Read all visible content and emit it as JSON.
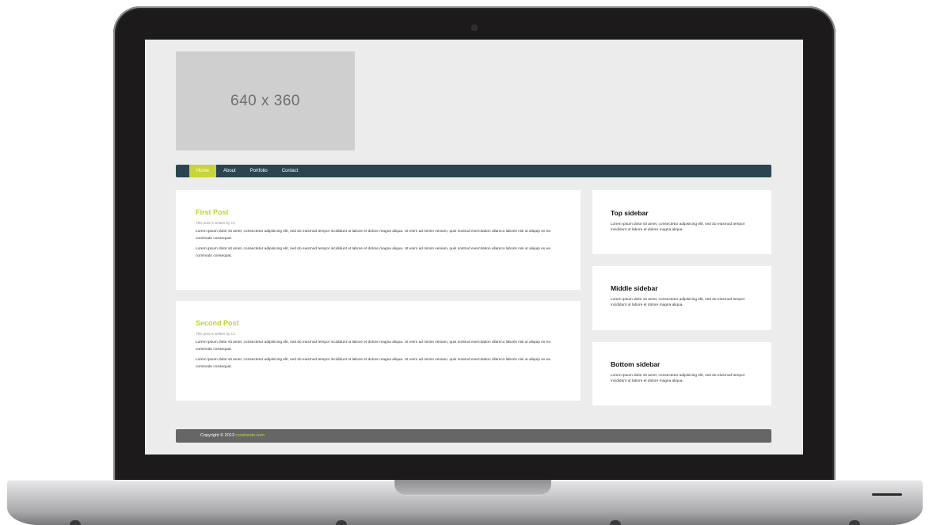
{
  "placeholder": {
    "label": "640 x 360"
  },
  "nav": {
    "items": [
      {
        "label": "Home",
        "active": true
      },
      {
        "label": "About",
        "active": false
      },
      {
        "label": "Portfolio",
        "active": false
      },
      {
        "label": "Contact",
        "active": false
      }
    ]
  },
  "posts": [
    {
      "title": "First Post",
      "byline": "This post is written by CJ",
      "paragraphs": [
        "Lorem ipsum dolor sit amet, consectetur adipisicing elit, sed do eiusmod tempor incididunt ut labore et dolore magna aliqua. Ut enim ad minim veniam, quis nostrud exercitation ullamco laboris nisi ut aliquip ex ea commodo consequat.",
        "Lorem ipsum dolor sit amet, consectetur adipisicing elit, sed do eiusmod tempor incididunt ut labore et dolore magna aliqua. Ut enim ad minim veniam, quis nostrud exercitation ullamco laboris nisi ut aliquip ex ea commodo consequat."
      ]
    },
    {
      "title": "Second Post",
      "byline": "This post is written by CJ",
      "paragraphs": [
        "Lorem ipsum dolor sit amet, consectetur adipisicing elit, sed do eiusmod tempor incididunt ut labore et dolore magna aliqua. Ut enim ad minim veniam, quis nostrud exercitation ullamco laboris nisi ut aliquip ex ea commodo consequat.",
        "Lorem ipsum dolor sit amet, consectetur adipisicing elit, sed do eiusmod tempor incididunt ut labore et dolore magna aliqua. Ut enim ad minim veniam, quis nostrud exercitation ullamco laboris nisi ut aliquip ex ea commodo consequat."
      ]
    }
  ],
  "sidebar": [
    {
      "title": "Top sidebar",
      "body": "Lorem ipsum dolor sit amet, consectetur adipisicing elit, sed do eiusmod tempor incididunt ut labore et dolore magna aliqua."
    },
    {
      "title": "Middle sidebar",
      "body": "Lorem ipsum dolor sit amet, consectetur adipisicing elit, sed do eiusmod tempor incididunt ut labore et dolore magna aliqua."
    },
    {
      "title": "Bottom sidebar",
      "body": "Lorem ipsum dolor sit amet, consectetur adipisicing elit, sed do eiusmod tempor incididunt ut labore et dolore magna aliqua."
    }
  ],
  "footer": {
    "copyright": "Copyright © 2013",
    "link": "csssheets.com"
  },
  "colors": {
    "accent": "#c8d43a",
    "nav_background": "#2a4550",
    "footer_background": "#666666",
    "page_background": "#ececec",
    "laptop_bezel": "#1c1a1a"
  }
}
